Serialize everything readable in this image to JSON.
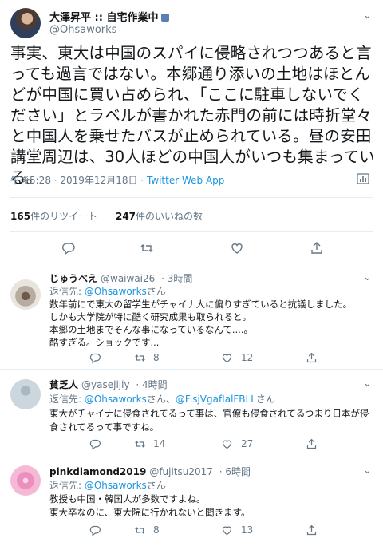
{
  "main_tweet": {
    "display_name": "大澤昇平 :: 自宅作業中",
    "handle": "@Ohsaworks",
    "text": "事実、東大は中国のスパイに侵略されつつあると言っても過言ではない。本郷通り添いの土地はほとんどが中国に買い占められ、「ここに駐車しないでください」とラベルが書かれた赤門の前には時折堂々と中国人を乗せたバスが止められている。昼の安田講堂周辺は、30人ほどの中国人がいつも集まっている。",
    "time": "午後5:28 · 2019年12月18日 ·",
    "source": "Twitter Web App",
    "retweets_count": "165",
    "retweets_label": "件のリツイート",
    "likes_count": "247",
    "likes_label": "件のいいねの数"
  },
  "replies": [
    {
      "display_name": "じゅうべえ",
      "handle": "@waiwai26",
      "time": "· 3時間",
      "reply_prefix": "返信先: ",
      "reply_to": "@Ohsaworks",
      "reply_suffix": "さん",
      "text": "数年前にで東大の留学生がチャイナ人に偏りすぎていると抗議しました。\nしかも大学院が特に酷く研究成果も取られると。\n本郷の土地までそんな事になっているなんて....。\n酷すぎる。ショックです...",
      "retweets": "8",
      "likes": "12"
    },
    {
      "display_name": "貧乏人",
      "handle": "@yasejijiy",
      "time": "· 4時間",
      "reply_prefix": "返信先: ",
      "reply_to": "@Ohsaworks",
      "reply_mid": "さん、",
      "reply_to_2": "@FisjVgafIalFBLL",
      "reply_suffix": "さん",
      "text": "東大がチャイナに侵食されてるって事は、官僚も侵食されてるつまり日本が侵食されてるって事ですね。",
      "retweets": "14",
      "likes": "27"
    },
    {
      "display_name": "pinkdiamond2019",
      "handle": "@fujitsu2017",
      "time": "· 6時間",
      "reply_prefix": "返信先: ",
      "reply_to": "@Ohsaworks",
      "reply_suffix": "さん",
      "text": "教授も中国・韓国人が多数ですよね。\n東大卒なのに、東大院に行かれないと聞きます。",
      "retweets": "8",
      "likes": "13"
    }
  ],
  "icons": [
    "chevron-down-icon",
    "reply-icon",
    "retweet-icon",
    "like-icon",
    "share-icon",
    "analytics-icon"
  ],
  "colors": {
    "accent": "#1b95e0",
    "muted": "#657786",
    "text": "#14171a",
    "divider": "#e6ecf0"
  }
}
